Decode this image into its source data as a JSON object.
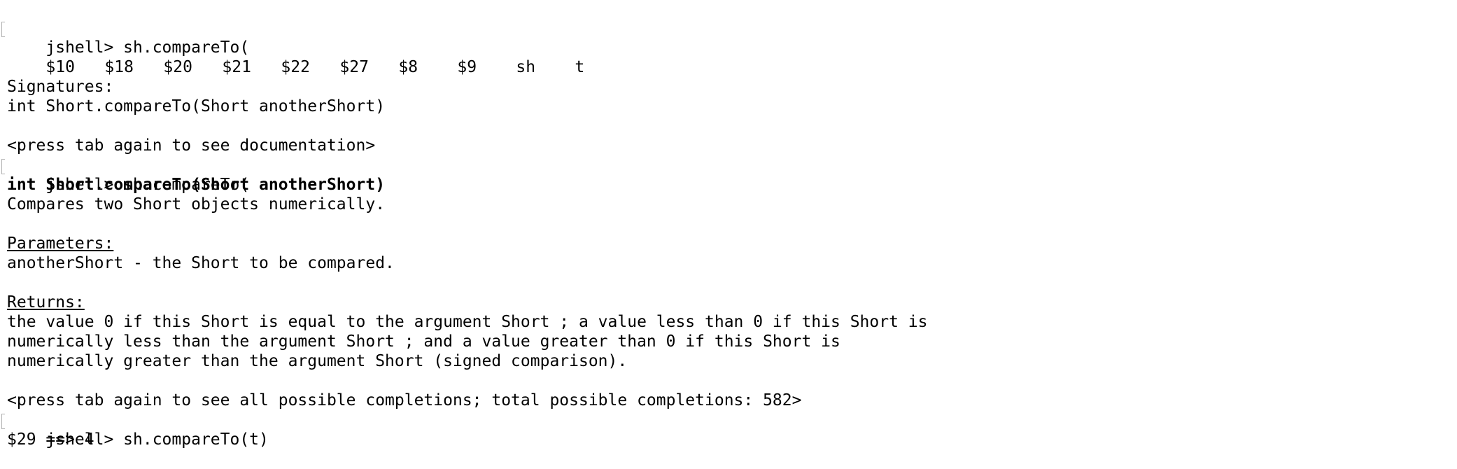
{
  "prompt_lines": [
    "jshell> sh.compareTo(",
    "jshell> sh.compareTo(",
    "jshell> sh.compareTo(t)"
  ],
  "completions": [
    "$10",
    "$18",
    "$20",
    "$21",
    "$22",
    "$27",
    "$8",
    "$9",
    "sh",
    "t"
  ],
  "signatures_header": "Signatures:",
  "signature": "int Short.compareTo(Short anotherShort)",
  "press_tab_doc": "<press tab again to see documentation>",
  "doc_signature": "int Short.compareTo(Short anotherShort)",
  "doc_summary": "Compares two Short objects numerically.",
  "parameters_header": "Parameters:",
  "parameter_desc": "anotherShort - the Short to be compared.",
  "returns_header": "Returns:",
  "returns_lines": [
    "the value 0 if this Short is equal to the argument Short ; a value less than 0 if this Short is",
    "numerically less than the argument Short ; and a value greater than 0 if this Short is",
    "numerically greater than the argument Short (signed comparison)."
  ],
  "press_tab_completions": "<press tab again to see all possible completions; total possible completions: 582>",
  "result": "$29 ==> 4"
}
